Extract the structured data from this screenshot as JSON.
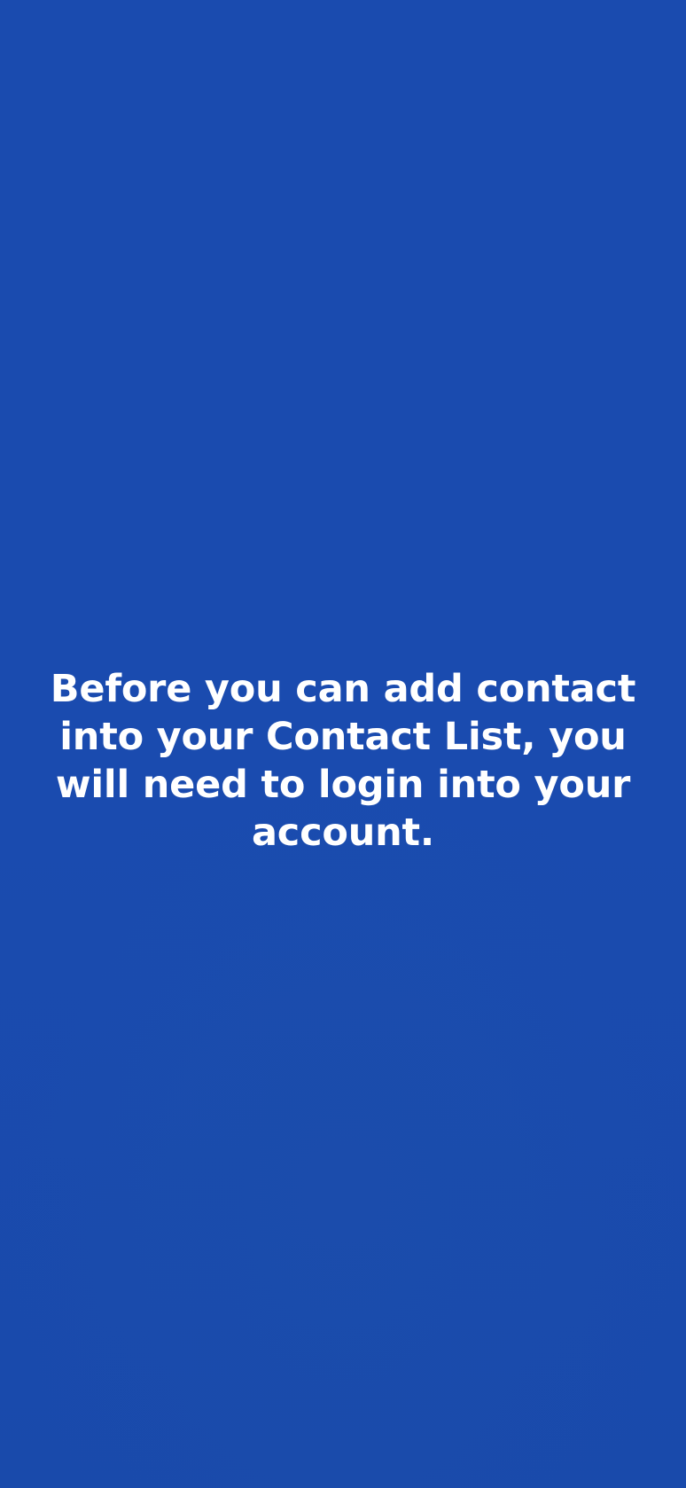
{
  "screen": {
    "background_color": "#1a4baf",
    "text_color": "#ffffff",
    "message": "Before you can add contact into your Contact List, you will need to login into your account."
  }
}
